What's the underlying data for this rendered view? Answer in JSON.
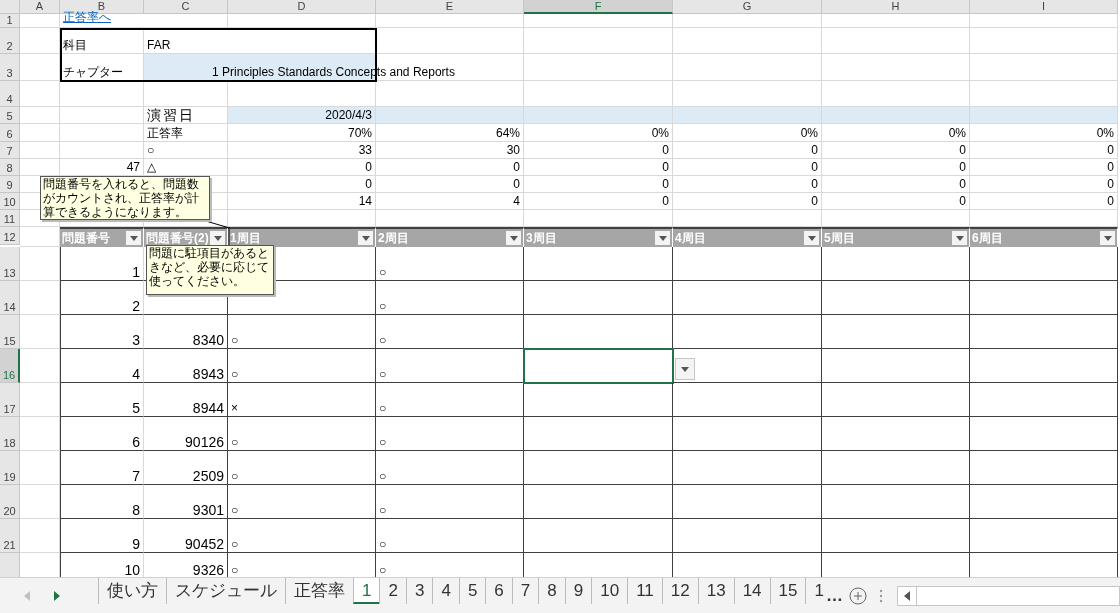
{
  "column_headers": [
    {
      "label": "A",
      "selected": false
    },
    {
      "label": "B",
      "selected": false
    },
    {
      "label": "C",
      "selected": false
    },
    {
      "label": "D",
      "selected": false
    },
    {
      "label": "E",
      "selected": false
    },
    {
      "label": "F",
      "selected": true
    },
    {
      "label": "G",
      "selected": false
    },
    {
      "label": "H",
      "selected": false
    },
    {
      "label": "I",
      "selected": false
    }
  ],
  "row_headers": [
    {
      "label": "1",
      "selected": false
    },
    {
      "label": "2",
      "selected": false
    },
    {
      "label": "3",
      "selected": false
    },
    {
      "label": "4",
      "selected": false
    },
    {
      "label": "5",
      "selected": false
    },
    {
      "label": "6",
      "selected": false
    },
    {
      "label": "7",
      "selected": false
    },
    {
      "label": "8",
      "selected": false
    },
    {
      "label": "9",
      "selected": false
    },
    {
      "label": "10",
      "selected": false
    },
    {
      "label": "11",
      "selected": false
    },
    {
      "label": "12",
      "selected": false
    },
    {
      "label": "13",
      "selected": false
    },
    {
      "label": "14",
      "selected": false
    },
    {
      "label": "15",
      "selected": false
    },
    {
      "label": "16",
      "selected": true
    },
    {
      "label": "17",
      "selected": false
    },
    {
      "label": "18",
      "selected": false
    },
    {
      "label": "19",
      "selected": false
    },
    {
      "label": "20",
      "selected": false
    },
    {
      "label": "21",
      "selected": false
    }
  ],
  "link": "正答率へ",
  "info_table": [
    {
      "label": "科目",
      "value": "FAR"
    },
    {
      "label": "チャプター",
      "value": "1 Principles Standards Concepts and Reports"
    }
  ],
  "summary": {
    "date_label": "演習日",
    "date": "2020/4/3",
    "count": "47",
    "rows": [
      {
        "label": "正答率",
        "values": [
          "70%",
          "64%",
          "0%",
          "0%",
          "0%",
          "0%"
        ]
      },
      {
        "label": "○",
        "values": [
          "33",
          "30",
          "0",
          "0",
          "0",
          "0"
        ]
      },
      {
        "label": "△",
        "values": [
          "0",
          "0",
          "0",
          "0",
          "0",
          "0"
        ]
      },
      {
        "values": [
          "0",
          "0",
          "0",
          "0",
          "0",
          "0"
        ]
      },
      {
        "values": [
          "14",
          "4",
          "0",
          "0",
          "0",
          "0"
        ]
      }
    ]
  },
  "table": {
    "columns": [
      "問題番号",
      "問題番号(2)",
      "1周目",
      "2周目",
      "3周目",
      "4周目",
      "5周目",
      "6周目"
    ],
    "rows": [
      {
        "number": "1",
        "round_2": "○"
      },
      {
        "number": "2",
        "round_2": "○"
      },
      {
        "number": "3",
        "number_2": "8340",
        "round_1": "○",
        "round_2": "○"
      },
      {
        "number": "4",
        "number_2": "8943",
        "round_1": "○",
        "round_2": "○"
      },
      {
        "number": "5",
        "number_2": "8944",
        "round_1": "×",
        "round_2": "○"
      },
      {
        "number": "6",
        "number_2": "90126",
        "round_1": "○",
        "round_2": "○"
      },
      {
        "number": "7",
        "number_2": "2509",
        "round_1": "○",
        "round_2": "○"
      },
      {
        "number": "8",
        "number_2": "9301",
        "round_1": "○",
        "round_2": "○"
      },
      {
        "number": "9",
        "number_2": "90452",
        "round_1": "○",
        "round_2": "○"
      },
      {
        "number": "10",
        "number_2": "9326",
        "round_1": "○",
        "round_2": "○"
      }
    ]
  },
  "comments": [
    "問題番号を入れると、問題数がカウントされ、正答率が計算できるようになります。",
    "問題に駐項目があるときなど、必要に応じて使ってください。"
  ],
  "sheet_tabs": [
    {
      "label": "使い方",
      "selected": false
    },
    {
      "label": "スケジュール",
      "selected": false
    },
    {
      "label": "正答率",
      "selected": false
    },
    {
      "label": "1",
      "selected": true
    },
    {
      "label": "2",
      "selected": false
    },
    {
      "label": "3",
      "selected": false
    },
    {
      "label": "4",
      "selected": false
    },
    {
      "label": "5",
      "selected": false
    },
    {
      "label": "6",
      "selected": false
    },
    {
      "label": "7",
      "selected": false
    },
    {
      "label": "8",
      "selected": false
    },
    {
      "label": "9",
      "selected": false
    },
    {
      "label": "10",
      "selected": false
    },
    {
      "label": "11",
      "selected": false
    },
    {
      "label": "12",
      "selected": false
    },
    {
      "label": "13",
      "selected": false
    },
    {
      "label": "14",
      "selected": false
    },
    {
      "label": "15",
      "selected": false
    },
    {
      "label": "1",
      "selected": false
    }
  ],
  "more_tabs": "…"
}
